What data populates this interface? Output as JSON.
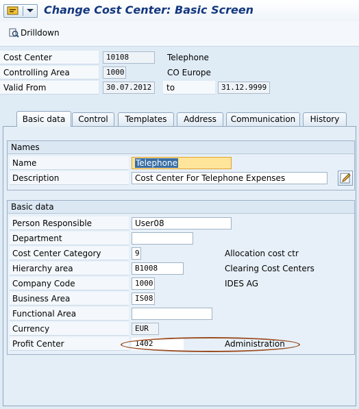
{
  "window": {
    "title": "Change Cost Center: Basic Screen"
  },
  "toolbar": {
    "drilldown_label": "Drilldown"
  },
  "header": {
    "cost_center_label": "Cost Center",
    "cost_center_value": "10108",
    "cost_center_desc": "Telephone",
    "controlling_area_label": "Controlling Area",
    "controlling_area_value": "1000",
    "controlling_area_desc": "CO Europe",
    "valid_from_label": "Valid From",
    "valid_from_value": "30.07.2012",
    "to_label": "to",
    "valid_to_value": "31.12.9999"
  },
  "tabs": [
    {
      "label": "Basic data",
      "active": true
    },
    {
      "label": "Control"
    },
    {
      "label": "Templates"
    },
    {
      "label": "Address"
    },
    {
      "label": "Communication"
    },
    {
      "label": "History"
    }
  ],
  "names": {
    "heading": "Names",
    "name_label": "Name",
    "name_value": "Telephone",
    "description_label": "Description",
    "description_value": "Cost Center For Telephone Expenses"
  },
  "basic_data": {
    "heading": "Basic data",
    "person_responsible_label": "Person Responsible",
    "person_responsible_value": "User08",
    "department_label": "Department",
    "department_value": "",
    "category_label": "Cost Center Category",
    "category_value": "9",
    "category_desc": "Allocation cost ctr",
    "hierarchy_label": "Hierarchy area",
    "hierarchy_value": "B1008",
    "hierarchy_desc": "Clearing Cost Centers",
    "company_code_label": "Company Code",
    "company_code_value": "1000",
    "company_code_desc": "IDES AG",
    "business_area_label": "Business Area",
    "business_area_value": "IS08",
    "functional_area_label": "Functional Area",
    "functional_area_value": "",
    "currency_label": "Currency",
    "currency_value": "EUR",
    "profit_center_label": "Profit Center",
    "profit_center_value": "1402",
    "profit_center_desc": "Administration"
  },
  "colors": {
    "title": "#14387f",
    "highlight_field": "#ffe59a",
    "annotation_oval": "#9a4a1f"
  }
}
